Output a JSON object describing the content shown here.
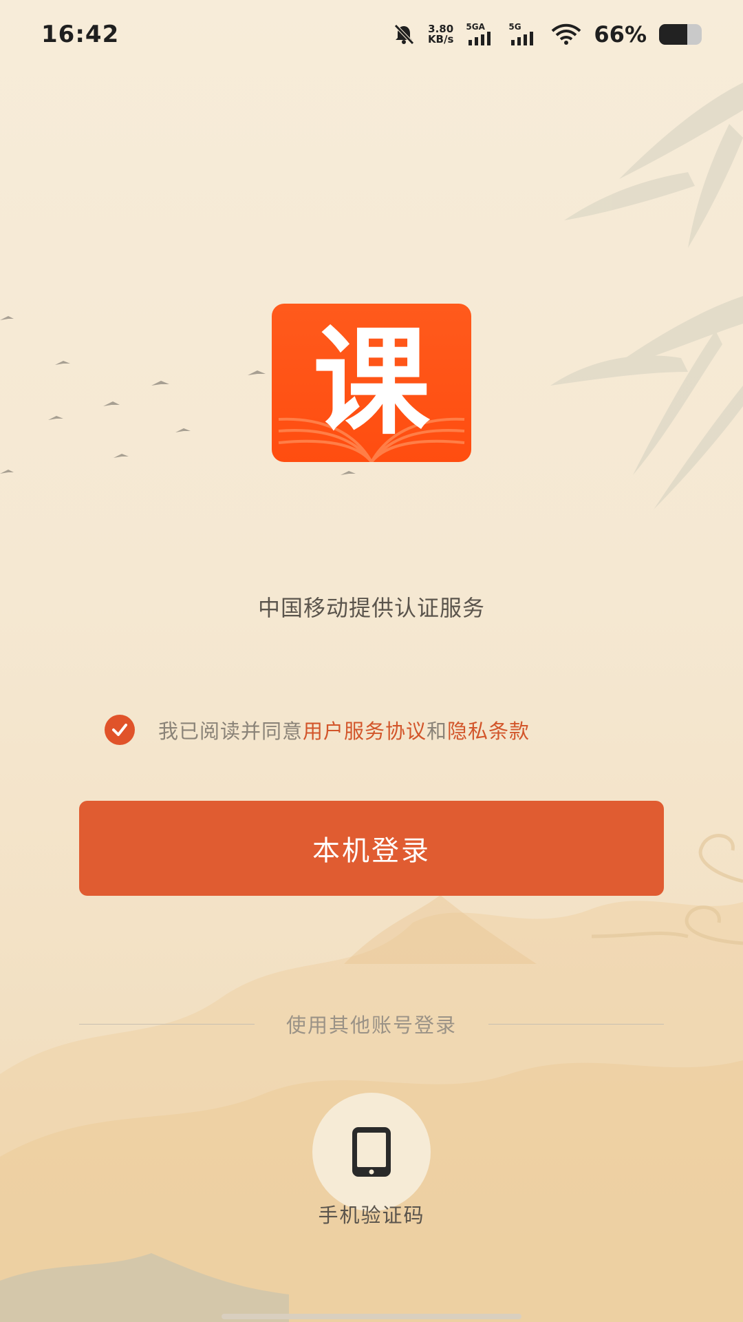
{
  "status_bar": {
    "time": "16:42",
    "net_speed_value": "3.80",
    "net_speed_unit": "KB/s",
    "sim1_label": "5GA",
    "sim2_label": "5G",
    "battery_percent_text": "66%",
    "battery_level": 0.66
  },
  "logo": {
    "char": "课"
  },
  "auth_provider_text": "中国移动提供认证服务",
  "agreement": {
    "checked": true,
    "prefix": "我已阅读并同意",
    "user_agreement_link": "用户服务协议",
    "conjunction": "和",
    "privacy_link": "隐私条款"
  },
  "login_button_label": "本机登录",
  "other_login": {
    "divider_text": "使用其他账号登录",
    "phone_code_label": "手机验证码"
  },
  "colors": {
    "accent": "#e05c31",
    "logo_bg": "#ff5212",
    "link": "#d2552a",
    "background": "#f5e8d2"
  }
}
